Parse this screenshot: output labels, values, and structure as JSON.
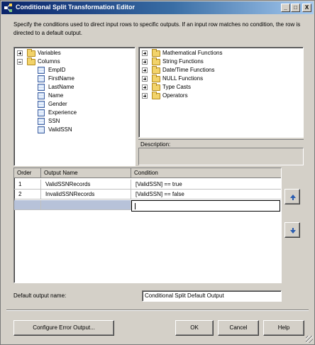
{
  "window": {
    "title": "Conditional Split Transformation Editor",
    "controls": {
      "minimize": "_",
      "maximize": "□",
      "close": "X"
    }
  },
  "description": "Specify the conditions used to direct input rows to specific outputs. If an input row matches no condition, the row is directed to a default output.",
  "left_tree": {
    "variables": "Variables",
    "columns": "Columns",
    "column_items": [
      "EmpID",
      "FirstName",
      "LastName",
      "Name",
      "Gender",
      "Experience",
      "SSN",
      "ValidSSN"
    ]
  },
  "right_tree": {
    "items": [
      "Mathematical Functions",
      "String Functions",
      "Date/Time Functions",
      "NULL Functions",
      "Type Casts",
      "Operators"
    ]
  },
  "description_panel": {
    "label": "Description:"
  },
  "grid": {
    "headers": {
      "order": "Order",
      "output_name": "Output Name",
      "condition": "Condition"
    },
    "rows": [
      {
        "order": "1",
        "output_name": "ValidSSNRecords",
        "condition": "[ValidSSN] == true"
      },
      {
        "order": "2",
        "output_name": "InvalidSSNRecords",
        "condition": "[ValidSSN] == false"
      }
    ]
  },
  "default_output": {
    "label": "Default output name:",
    "value": "Conditional Split Default Output"
  },
  "buttons": {
    "configure_error": "Configure Error Output...",
    "ok": "OK",
    "cancel": "Cancel",
    "help": "Help"
  },
  "colors": {
    "title_bar": "#0a246a",
    "dialog_bg": "#d4d0c8",
    "new_row": "#b7c2d9",
    "folder": "#f2d36b"
  }
}
